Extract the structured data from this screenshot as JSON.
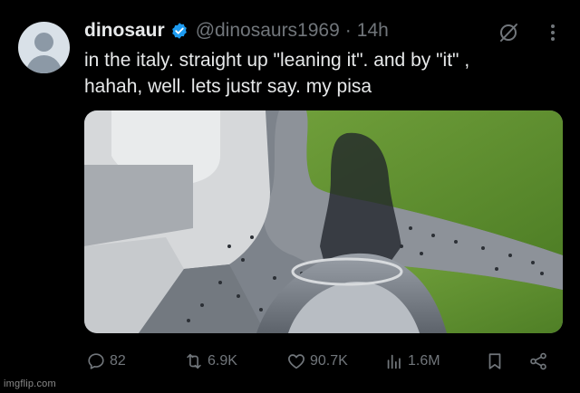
{
  "author": {
    "display_name": "dinosaur",
    "handle": "@dinosaurs1969",
    "separator": "·",
    "time": "14h",
    "verified": true
  },
  "tweet": {
    "line1": "in the italy. straight up \"leaning it\". and by \"it\" ,",
    "line2": "hahah, well. lets justr say. my pisa"
  },
  "icons": {
    "avatar": "default-avatar",
    "verified": "verified-badge-icon",
    "grok": "grok-icon",
    "more": "more-vertical-icon",
    "reply": "reply-icon",
    "repost": "repost-icon",
    "like": "heart-icon",
    "views": "views-icon",
    "bookmark": "bookmark-icon",
    "share": "share-icon"
  },
  "stats": {
    "replies": "82",
    "reposts": "6.9K",
    "likes": "90.7K",
    "views": "1.6M"
  },
  "watermark": "imgflip.com",
  "colors": {
    "background": "#000000",
    "text": "#e7e9ea",
    "muted": "#71767b",
    "verified": "#1d9bf0",
    "grass": "#5c8f2f",
    "path": "#8a8f96"
  }
}
